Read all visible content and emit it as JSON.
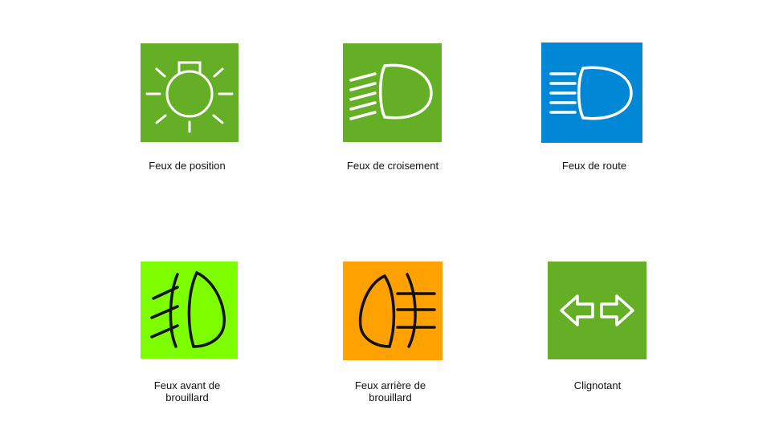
{
  "colors": {
    "green": "#64AF25",
    "blue": "#0087D5",
    "lime": "#7DFF00",
    "orange": "#FFA100"
  },
  "icons": [
    {
      "name": "position-lights-icon",
      "bg": "green",
      "label_lines": [
        "Feux de position"
      ]
    },
    {
      "name": "low-beam-icon",
      "bg": "green",
      "label_lines": [
        "Feux de croisement"
      ]
    },
    {
      "name": "high-beam-icon",
      "bg": "blue",
      "label_lines": [
        "Feux de route"
      ]
    },
    {
      "name": "front-fog-lights-icon",
      "bg": "lime",
      "label_lines": [
        "Feux avant de",
        "brouillard"
      ]
    },
    {
      "name": "rear-fog-lights-icon",
      "bg": "orange",
      "label_lines": [
        "Feux arrière de",
        "brouillard"
      ]
    },
    {
      "name": "turn-signal-icon",
      "bg": "green",
      "label_lines": [
        "Clignotant"
      ]
    }
  ]
}
